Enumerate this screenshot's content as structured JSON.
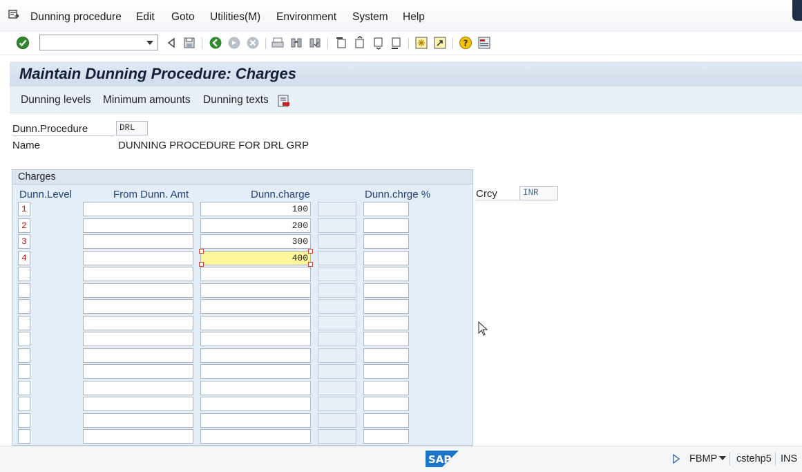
{
  "menu": {
    "items": [
      {
        "label": "Dunning procedure",
        "key": "D"
      },
      {
        "label": "Edit",
        "key": "E"
      },
      {
        "label": "Goto",
        "key": "G"
      },
      {
        "label": "Utilities(M)",
        "key": "M"
      },
      {
        "label": "Environment",
        "key": "v"
      },
      {
        "label": "System",
        "key": "y"
      },
      {
        "label": "Help",
        "key": "H"
      }
    ]
  },
  "toolbar": {
    "command_field_value": "",
    "icons": [
      "enter-icon",
      "back-icon",
      "save-icon",
      "back-green-icon",
      "exit-icon",
      "cancel-icon",
      "print-icon",
      "find-icon",
      "find-next-icon",
      "first-page-icon",
      "previous-page-icon",
      "next-page-icon",
      "last-page-icon",
      "create-session-icon",
      "shortcut-icon",
      "help-icon",
      "layout-menu-icon"
    ]
  },
  "page": {
    "title": "Maintain Dunning Procedure: Charges"
  },
  "app_toolbar": {
    "btn1": "Dunning levels",
    "btn2": "Minimum amounts",
    "btn3": "Dunning texts"
  },
  "header": {
    "procedure_label": "Dunn.Procedure",
    "procedure_value": "DRL",
    "name_label": "Name",
    "name_value": "DUNNING PROCEDURE FOR DRL GRP"
  },
  "charges": {
    "title": "Charges",
    "col_level": "Dunn.Level",
    "col_from": "From Dunn. Amt",
    "col_charge": "Dunn.charge",
    "col_pct": "Dunn.chrge %",
    "currency_label": "Crcy",
    "currency_value": "INR",
    "rows": [
      {
        "level": "1",
        "from": "",
        "charge": "100",
        "pct": ""
      },
      {
        "level": "2",
        "from": "",
        "charge": "200",
        "pct": ""
      },
      {
        "level": "3",
        "from": "",
        "charge": "300",
        "pct": ""
      },
      {
        "level": "4",
        "from": "",
        "charge": "400",
        "pct": ""
      },
      {
        "level": "",
        "from": "",
        "charge": "",
        "pct": ""
      },
      {
        "level": "",
        "from": "",
        "charge": "",
        "pct": ""
      },
      {
        "level": "",
        "from": "",
        "charge": "",
        "pct": ""
      },
      {
        "level": "",
        "from": "",
        "charge": "",
        "pct": ""
      },
      {
        "level": "",
        "from": "",
        "charge": "",
        "pct": ""
      },
      {
        "level": "",
        "from": "",
        "charge": "",
        "pct": ""
      },
      {
        "level": "",
        "from": "",
        "charge": "",
        "pct": ""
      },
      {
        "level": "",
        "from": "",
        "charge": "",
        "pct": ""
      },
      {
        "level": "",
        "from": "",
        "charge": "",
        "pct": ""
      },
      {
        "level": "",
        "from": "",
        "charge": "",
        "pct": ""
      },
      {
        "level": "",
        "from": "",
        "charge": "",
        "pct": ""
      }
    ]
  },
  "status": {
    "logo": "SAP",
    "transaction": "FBMP",
    "server": "cstehp5",
    "mode": "INS"
  }
}
